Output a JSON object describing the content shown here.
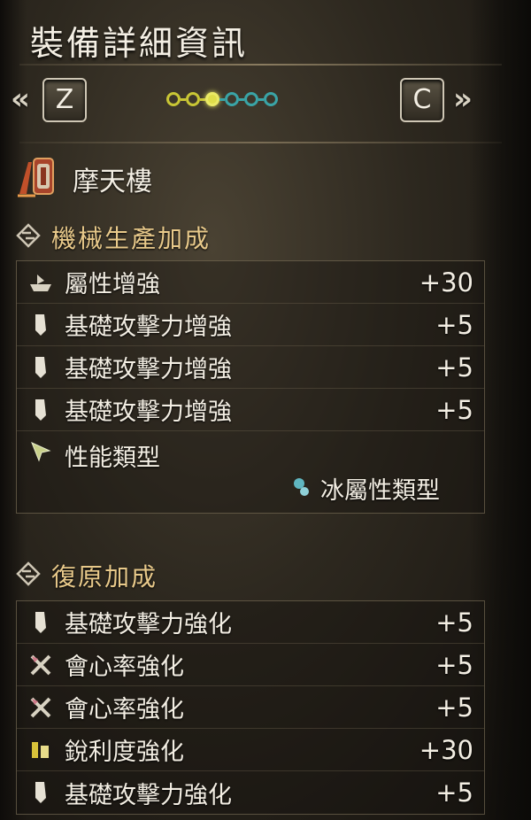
{
  "header": {
    "title": "裝備詳細資訊",
    "left_arrow": "«",
    "right_arrow": "»",
    "prev_key": "Z",
    "next_key": "C",
    "page_indicator": {
      "total": 6,
      "current": 3
    }
  },
  "item": {
    "name": "摩天樓",
    "icon": "gunlance-weapon-icon"
  },
  "sections": [
    {
      "title": "機械生產加成",
      "icon": "augment-crest-icon",
      "rows": [
        {
          "icon": "ship-icon",
          "label": "屬性增強",
          "value": "+30"
        },
        {
          "icon": "blade-icon",
          "label": "基礎攻擊力增強",
          "value": "+5"
        },
        {
          "icon": "blade-icon",
          "label": "基礎攻擊力增強",
          "value": "+5"
        },
        {
          "icon": "blade-icon",
          "label": "基礎攻擊力增強",
          "value": "+5"
        }
      ],
      "performance": {
        "icon": "arrow-cursor-icon",
        "label": "性能類型",
        "sub_icon": "ice-element-icon",
        "sub_label": "冰屬性類型"
      }
    },
    {
      "title": "復原加成",
      "icon": "augment-crest-icon",
      "rows": [
        {
          "icon": "blade-icon",
          "label": "基礎攻擊力強化",
          "value": "+5"
        },
        {
          "icon": "crossed-swords-icon",
          "label": "會心率強化",
          "value": "+5"
        },
        {
          "icon": "crossed-swords-icon",
          "label": "會心率強化",
          "value": "+5"
        },
        {
          "icon": "sharpness-icon",
          "label": "銳利度強化",
          "value": "+30"
        },
        {
          "icon": "blade-icon",
          "label": "基礎攻擊力強化",
          "value": "+5"
        }
      ]
    }
  ],
  "colors": {
    "section_title": "#e8c98a",
    "dot_yellow": "#c9c635",
    "dot_teal": "#3aa4a6",
    "text": "#f3eee3"
  }
}
